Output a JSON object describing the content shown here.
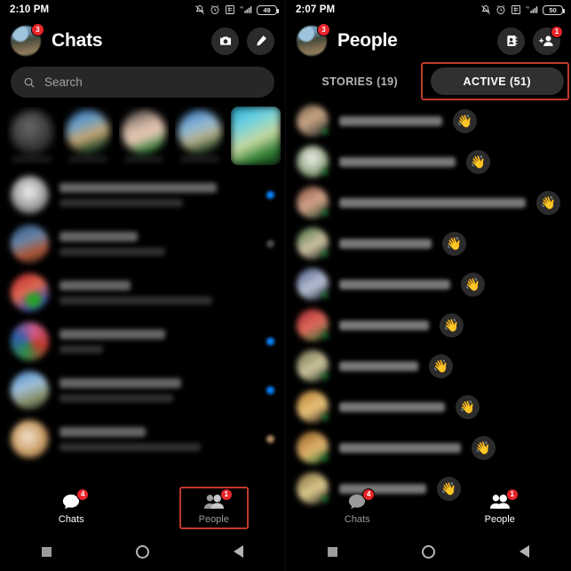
{
  "left": {
    "status": {
      "time": "2:10 PM",
      "battery": "49",
      "network": "4G",
      "icons": [
        "mute-icon",
        "alarm-icon",
        "screenshot-icon",
        "signal-icon",
        "battery-icon"
      ]
    },
    "header": {
      "title": "Chats",
      "avatar_badge": "3",
      "camera_label": "camera-button",
      "compose_label": "compose-button"
    },
    "search": {
      "placeholder": "Search"
    },
    "stories": [
      {
        "name": "story-1"
      },
      {
        "name": "story-2"
      },
      {
        "name": "story-3"
      },
      {
        "name": "story-4"
      },
      {
        "name": "story-5"
      }
    ],
    "chats": [
      {
        "indicator": "blue",
        "avatar": "av-bright"
      },
      {
        "indicator": "grey",
        "avatar": "av-blue"
      },
      {
        "indicator": "none",
        "avatar": "av-red"
      },
      {
        "indicator": "blue",
        "avatar": "av-pink"
      },
      {
        "indicator": "blue",
        "avatar": "av-sky"
      },
      {
        "indicator": "tan",
        "avatar": "av-tan"
      }
    ],
    "nav": [
      {
        "label": "Chats",
        "badge": "4",
        "state": "active",
        "icon": "chat-bubble-icon"
      },
      {
        "label": "People",
        "badge": "1",
        "state": "idle",
        "icon": "people-icon",
        "highlighted": true
      }
    ]
  },
  "right": {
    "status": {
      "time": "2:07 PM",
      "battery": "50",
      "network": "4G",
      "icons": [
        "mute-icon",
        "alarm-icon",
        "screenshot-icon",
        "signal-icon",
        "battery-icon"
      ]
    },
    "header": {
      "title": "People",
      "avatar_badge": "3",
      "contacts_label": "contacts-button",
      "add_person_label": "add-person-button",
      "add_person_badge": "1"
    },
    "tabs": [
      {
        "label": "STORIES (19)",
        "active": false
      },
      {
        "label": "ACTIVE (51)",
        "active": true,
        "highlighted": true
      }
    ],
    "people": [
      {
        "avatar": "p-1",
        "wave": "wave-button"
      },
      {
        "avatar": "p-2",
        "wave": "wave-button"
      },
      {
        "avatar": "p-3",
        "wave": "wave-button"
      },
      {
        "avatar": "p-4",
        "wave": "wave-button"
      },
      {
        "avatar": "p-5",
        "wave": "wave-button"
      },
      {
        "avatar": "p-6",
        "wave": "wave-button"
      },
      {
        "avatar": "p-7",
        "wave": "wave-button"
      },
      {
        "avatar": "p-8",
        "wave": "wave-button"
      },
      {
        "avatar": "p-9",
        "wave": "wave-button"
      },
      {
        "avatar": "p-10",
        "wave": "wave-button"
      }
    ],
    "nav": [
      {
        "label": "Chats",
        "badge": "4",
        "state": "idle",
        "icon": "chat-bubble-icon"
      },
      {
        "label": "People",
        "badge": "1",
        "state": "active",
        "icon": "people-icon"
      }
    ]
  },
  "wave_glyph": "👋",
  "colors": {
    "highlight": "#c0392b",
    "badge_red": "#e8252a",
    "unread_blue": "#0a84ff",
    "online_green": "#2bbb4e",
    "panel_grey": "#2b2b2b"
  }
}
